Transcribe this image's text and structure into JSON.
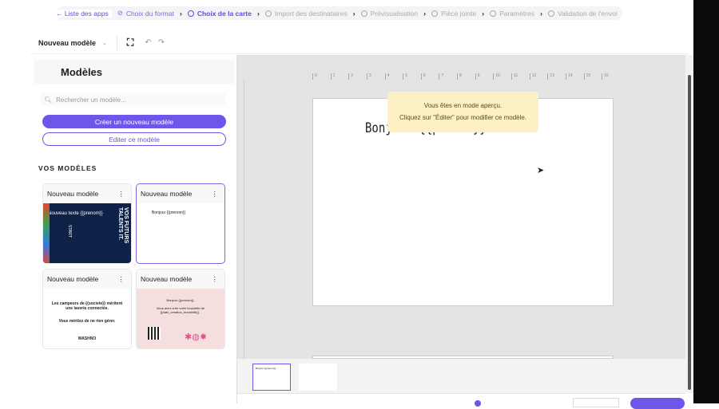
{
  "breadcrumb": {
    "back": "Liste des apps",
    "steps": [
      {
        "label": "Choix du format",
        "state": "done"
      },
      {
        "label": "Choix de la carte",
        "state": "active"
      },
      {
        "label": "Import des destinataires",
        "state": "todo"
      },
      {
        "label": "Prévisualisation",
        "state": "todo"
      },
      {
        "label": "Pièce jointe",
        "state": "todo"
      },
      {
        "label": "Paramètres",
        "state": "todo"
      },
      {
        "label": "Validation de l'envoi",
        "state": "todo"
      }
    ]
  },
  "toolbar": {
    "model_select": "Nouveau modèle"
  },
  "sidebar": {
    "title": "Modèles",
    "search_placeholder": "Rechercher un modèle...",
    "create_label": "Créer un nouveau modèle",
    "edit_label": "Editer ce modèle",
    "section": "VOS MODÈLES",
    "cards": [
      {
        "title": "Nouveau modèle",
        "preview": "Nouveau texte {{prenom}}",
        "preview2": "VOS FUTURS TALENTS IT.",
        "preview3": "START"
      },
      {
        "title": "Nouveau modèle",
        "preview": "Bonjour {{prenom}}",
        "selected": true
      },
      {
        "title": "Nouveau modèle",
        "preview": "Les campeurs de {{societe}} méritent une laverie connectée.",
        "preview2": "Vous méritez de ne rien gérer.",
        "preview3": "WASHNO"
      },
      {
        "title": "Nouveau modèle",
        "preview": "Bonjour {{prenom}},",
        "preview2": "Vous avez créé votre bouclette de {{date_creation_bouclette}} ."
      }
    ]
  },
  "ruler": [
    "0",
    "1",
    "2",
    "3",
    "4",
    "5",
    "6",
    "7",
    "8",
    "9",
    "10",
    "11",
    "12",
    "13",
    "14",
    "15",
    "16"
  ],
  "canvas": {
    "text": "Bonjour {{prenom}}",
    "tooltip_line1": "Vous êtes en mode aperçu.",
    "tooltip_line2": "Cliquez sur \"Éditer\" pour modifier ce modèle."
  },
  "thumbnails": [
    {
      "text": "Bonjour {{prenom}}"
    },
    {
      "text": ""
    }
  ],
  "colors": {
    "accent": "#7055ea",
    "tooltip": "#fdf1c4",
    "canvas_bg": "#e4e4e4"
  }
}
